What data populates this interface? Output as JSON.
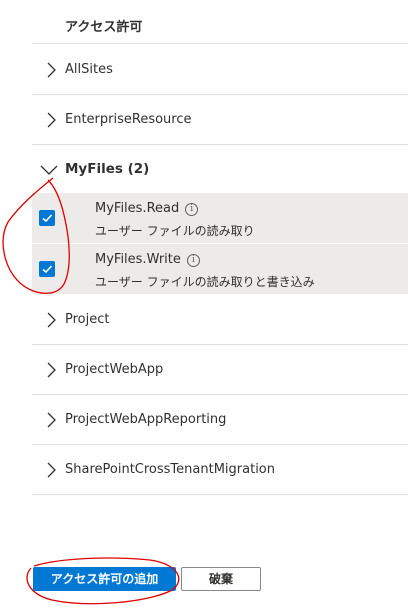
{
  "header": {
    "title": "アクセス許可"
  },
  "groups_before": [
    {
      "label": "AllSites"
    },
    {
      "label": "EnterpriseResource"
    }
  ],
  "expanded_group": {
    "label": "MyFiles (2)",
    "permissions": [
      {
        "name": "MyFiles.Read",
        "description": "ユーザー ファイルの読み取り",
        "checked": true
      },
      {
        "name": "MyFiles.Write",
        "description": "ユーザー ファイルの読み取りと書き込み",
        "checked": true
      }
    ]
  },
  "groups_after": [
    {
      "label": "Project"
    },
    {
      "label": "ProjectWebApp"
    },
    {
      "label": "ProjectWebAppReporting"
    },
    {
      "label": "SharePointCrossTenantMigration"
    }
  ],
  "buttons": {
    "add_label": "アクセス許可の追加",
    "discard_label": "破棄"
  },
  "colors": {
    "accent": "#0078d4",
    "selected_row": "#edebe9",
    "annotation": "#e00000"
  }
}
